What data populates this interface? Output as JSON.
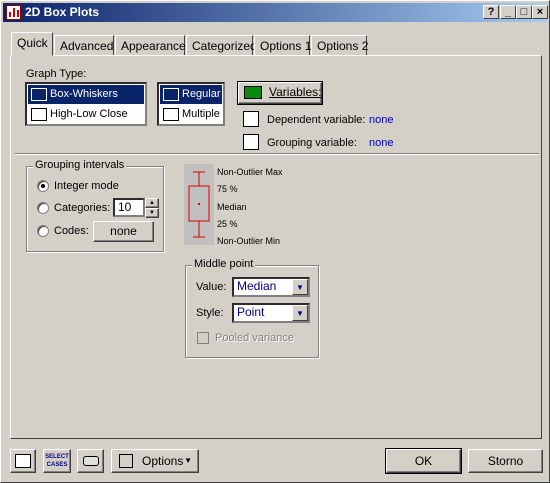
{
  "window": {
    "title": "2D Box Plots",
    "buttons": {
      "help": "?",
      "minimize": "_",
      "maximize": "□",
      "close": "×"
    }
  },
  "tabs": [
    "Quick",
    "Advanced",
    "Appearance",
    "Categorized",
    "Options 1",
    "Options 2"
  ],
  "graph_type": {
    "label": "Graph Type:",
    "types": [
      "Box-Whiskers",
      "High-Low Close"
    ],
    "modes": [
      "Regular",
      "Multiple"
    ]
  },
  "variables": {
    "button": "Variables:",
    "dependent_label": "Dependent variable:",
    "dependent_value": "none",
    "grouping_label": "Grouping variable:",
    "grouping_value": "none"
  },
  "grouping_intervals": {
    "title": "Grouping intervals",
    "integer_mode": "Integer mode",
    "categories": "Categories:",
    "categories_value": "10",
    "codes": "Codes:",
    "codes_button": "none"
  },
  "legend": {
    "max": "Non-Outlier Max",
    "p75": "75 %",
    "median": "Median",
    "p25": "25 %",
    "min": "Non-Outlier Min"
  },
  "middle_point": {
    "title": "Middle point",
    "value_label": "Value:",
    "value": "Median",
    "style_label": "Style:",
    "style": "Point",
    "pooled": "Pooled variance"
  },
  "bottom": {
    "select_cases": "SELECT CASES",
    "options": "Options",
    "ok": "OK",
    "cancel": "Storno"
  },
  "colors": {
    "title_start": "#0a246a",
    "title_end": "#a6caf0",
    "link": "#0000c0",
    "box_plot": "#e00000"
  },
  "icons": [
    "app-chart-icon",
    "variables-icon",
    "dependent-variable-icon",
    "grouping-variable-icon",
    "chart-graph-icon",
    "select-cases-icon",
    "printer-icon",
    "options-brush-icon"
  ]
}
